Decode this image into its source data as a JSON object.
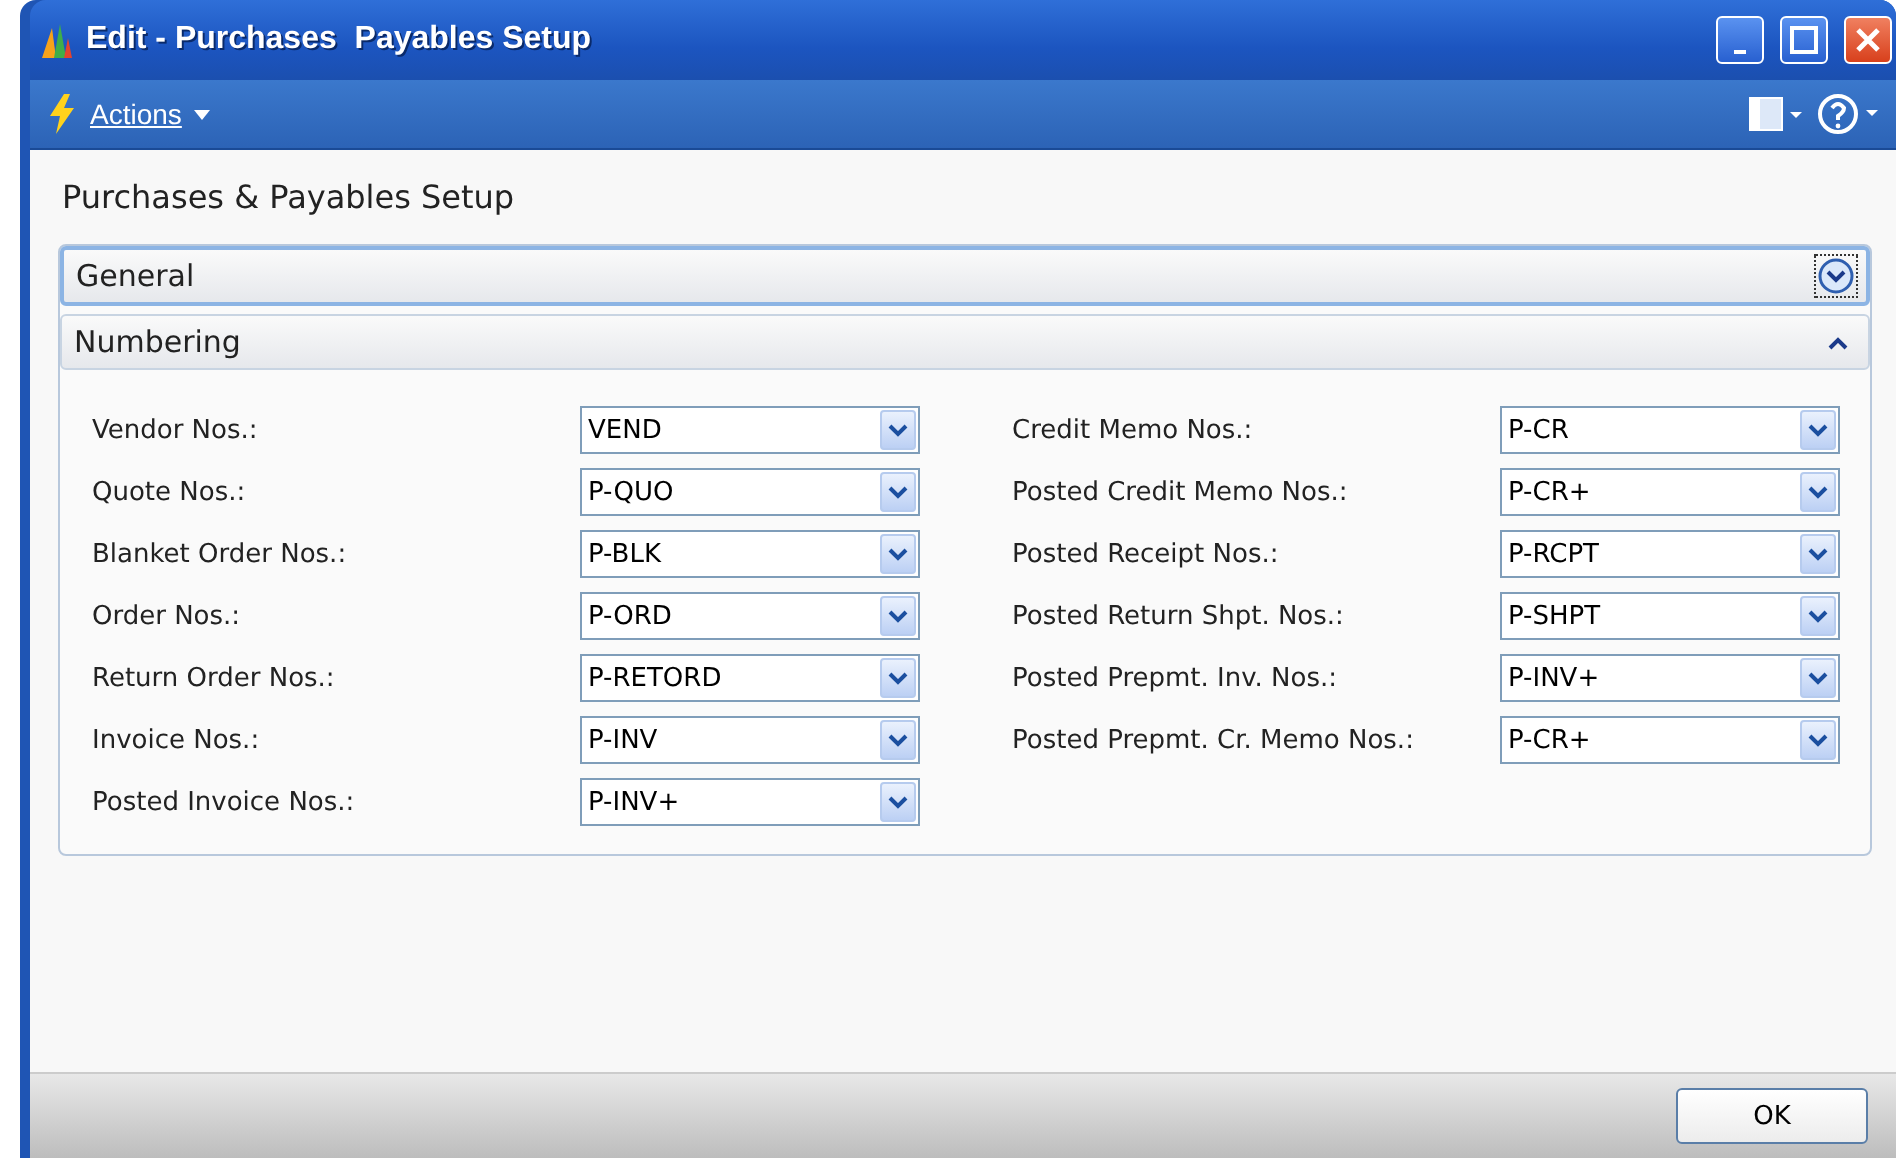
{
  "window": {
    "title": "Edit - Purchases  Payables Setup"
  },
  "toolbar": {
    "actions_label": "Actions"
  },
  "page_title": "Purchases & Payables Setup",
  "sections": [
    {
      "title": "General",
      "expanded": false,
      "focused": true
    },
    {
      "title": "Numbering",
      "expanded": true,
      "focused": false,
      "columns": [
        [
          {
            "label": "Vendor Nos.:",
            "value": "VEND"
          },
          {
            "label": "Quote Nos.:",
            "value": "P-QUO"
          },
          {
            "label": "Blanket Order Nos.:",
            "value": "P-BLK"
          },
          {
            "label": "Order Nos.:",
            "value": "P-ORD"
          },
          {
            "label": "Return Order Nos.:",
            "value": "P-RETORD"
          },
          {
            "label": "Invoice Nos.:",
            "value": "P-INV"
          },
          {
            "label": "Posted Invoice Nos.:",
            "value": "P-INV+"
          }
        ],
        [
          {
            "label": "Credit Memo Nos.:",
            "value": "P-CR"
          },
          {
            "label": "Posted Credit Memo Nos.:",
            "value": "P-CR+"
          },
          {
            "label": "Posted Receipt Nos.:",
            "value": "P-RCPT"
          },
          {
            "label": "Posted Return Shpt. Nos.:",
            "value": "P-SHPT"
          },
          {
            "label": "Posted Prepmt. Inv. Nos.:",
            "value": "P-INV+"
          },
          {
            "label": "Posted Prepmt. Cr. Memo Nos.:",
            "value": "P-CR+"
          }
        ]
      ]
    }
  ],
  "buttons": [
    "OK"
  ]
}
